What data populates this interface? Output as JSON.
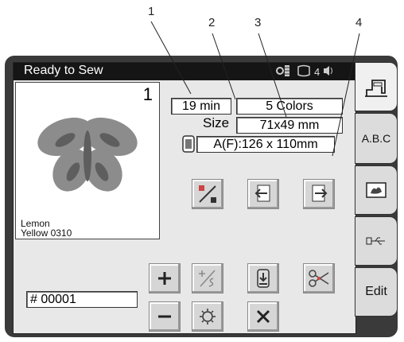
{
  "callouts": [
    "1",
    "2",
    "3",
    "4"
  ],
  "status": {
    "title": "Ready to Sew",
    "thread_count": "4"
  },
  "design": {
    "number": "1",
    "thread_color_name": "Lemon",
    "thread_color_code": "Yellow 0310",
    "sewing_time": "19 min",
    "color_count": "5 Colors",
    "size_label": "Size",
    "size_value": "71x49 mm",
    "hoop_value": "A(F):126 x 110mm"
  },
  "counter": {
    "value": "# 00001"
  },
  "tabs": [
    {
      "name": "sewing-machine-icon",
      "label": ""
    },
    {
      "name": "abc",
      "label": "A.B.C"
    },
    {
      "name": "design-icon",
      "label": ""
    },
    {
      "name": "usb-icon",
      "label": ""
    },
    {
      "name": "edit",
      "label": "Edit"
    }
  ],
  "colors": {
    "frame": "#3a3a3a",
    "screen": "#e8e8e8",
    "titlebar": "#151515",
    "butterfly": "#8c8c8c",
    "butterfly_dark": "#5e5e5e"
  }
}
